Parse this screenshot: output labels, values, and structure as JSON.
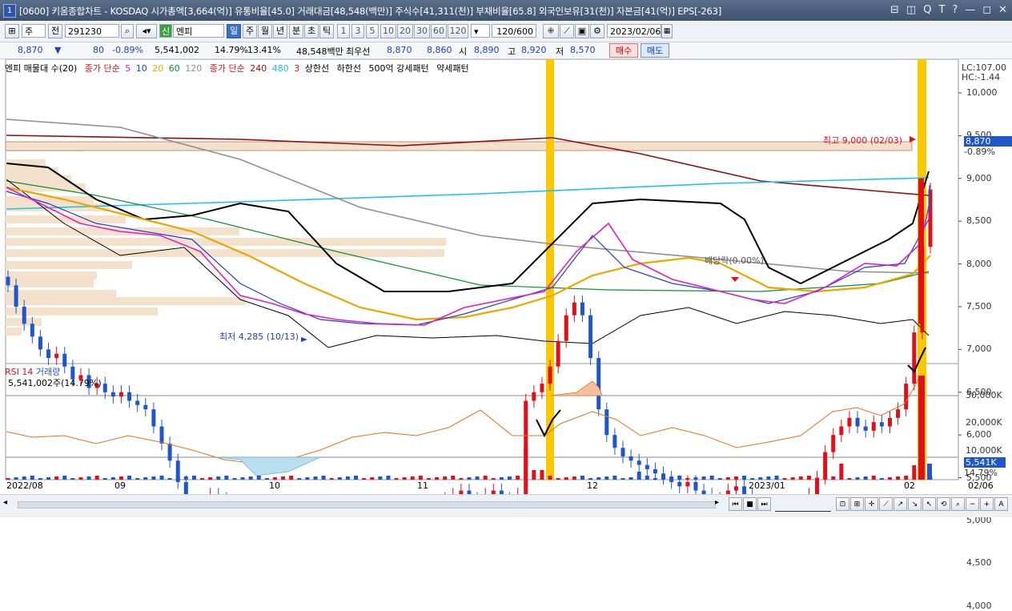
{
  "window": {
    "screen_no": "1",
    "title": "[0600] 키움종합차트 - KOSDAQ 시가총액[3,664(억)] 유통비율[45.0] 거래대금[48,548(백만)] 주식수[41,311(천)] 부채비율[65.8] 외국인보유[31(천)] 자본금[41(억)] EPS[-263]",
    "controls": [
      "⊟",
      "◫",
      "Q",
      "T",
      "?",
      "—",
      "◻",
      "✕"
    ]
  },
  "toolbar": {
    "period_select": "주",
    "prev_label": "전",
    "code": "291230",
    "stock_badge": "신",
    "stock_name": "엔피",
    "timeframes": [
      "일",
      "주",
      "월",
      "년",
      "분",
      "초",
      "틱"
    ],
    "active_timeframe": "일",
    "intervals": [
      "1",
      "3",
      "5",
      "10",
      "20",
      "30",
      "60",
      "120"
    ],
    "count": "120/600",
    "date": "2023/02/06"
  },
  "quote": {
    "price": "8,870",
    "change_arrow": "▼",
    "change": "80",
    "change_pct": "-0.89%",
    "volume": "5,541,002",
    "volume_pct": "14.79%",
    "turnover_pct": "13.41%",
    "amount": "48,548백만",
    "best_label": "최우선",
    "ask": "8,870",
    "bid": "8,860",
    "open_label": "시",
    "open": "8,890",
    "high_label": "고",
    "high": "8,920",
    "low_label": "저",
    "low": "8,570",
    "buy_label": "매수",
    "sell_label": "매도"
  },
  "legend": {
    "main": [
      "엔피 매물대 수(20)",
      "종가 단순",
      "5",
      "10",
      "20",
      "60",
      "120",
      "종가 단순",
      "240",
      "480",
      "3",
      "상한선",
      "하한선",
      "500억 강세패턴",
      "약세패턴"
    ],
    "sub": [
      "RSI 14",
      "거래량"
    ],
    "sub_value": "5,541,002주(14.79%)"
  },
  "colors": {
    "ma5": "#e020c0",
    "ma10": "#2040d0",
    "ma20": "#e8a800",
    "ma60": "#109030",
    "ma120": "#909090",
    "ma240": "#8b1010",
    "ma480": "#20c0f0",
    "band": "#000000",
    "highlight": "#f8c800",
    "up": "#e0101a",
    "down": "#1f56c8",
    "rsi": "#e87020",
    "volume_profile": "#f3e1cc"
  },
  "annotations": {
    "high": "최고 9,000 (02/03)",
    "low": "최저 4,285 (10/13)",
    "dividend": "배당락(0.00%)"
  },
  "right_axis": {
    "lc": "LC:107.00",
    "hc": "HC:-1.44",
    "price_ticks": [
      "10,000",
      "9,500",
      "9,000",
      "8,500",
      "8,000",
      "7,500",
      "7,000",
      "6,500",
      "6,000",
      "5,500",
      "5,000",
      "4,500",
      "4,000"
    ],
    "current_price": "8,870",
    "current_pct": "-0.89%",
    "volume_ticks": [
      "30,000K",
      "20,000K",
      "10,000K"
    ],
    "current_volume": "5,541K",
    "current_volume_pct": "14.79%"
  },
  "x_axis": [
    "2022/08",
    "09",
    "10",
    "11",
    "12",
    "2023/01",
    "02",
    "02/06"
  ]
}
